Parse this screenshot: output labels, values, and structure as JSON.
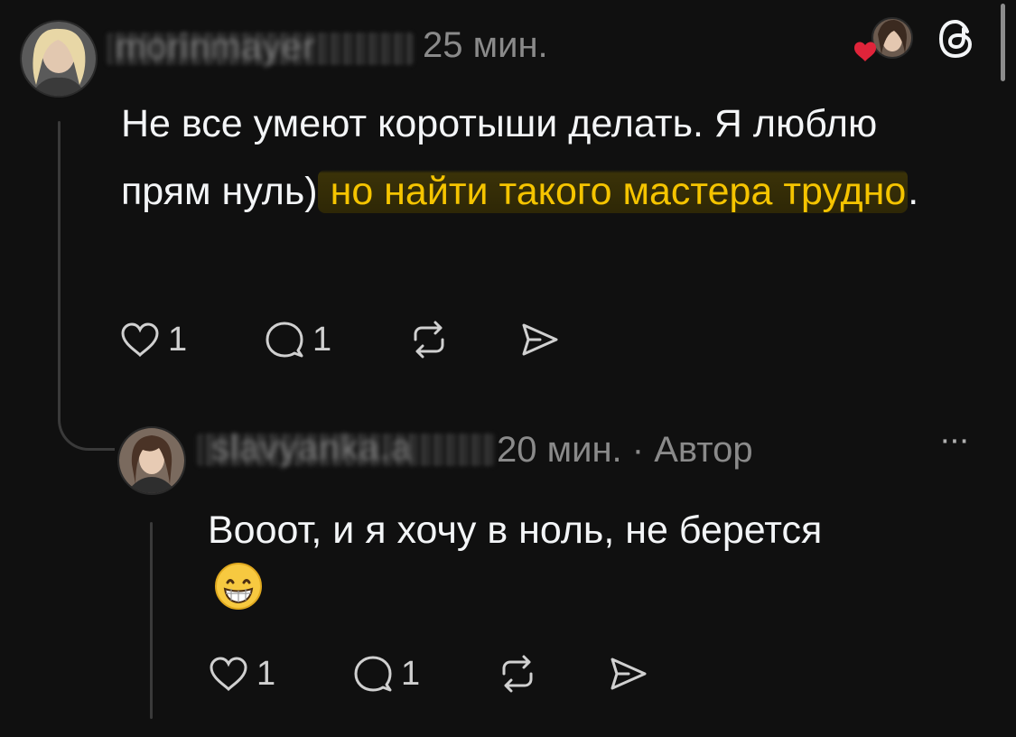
{
  "comment1": {
    "username": "morinmayer",
    "time": "25 мин.",
    "text_plain": "Не все умеют коротыши делать. Я люблю прям нуль)",
    "text_highlight": " но найти такого мастера трудно",
    "text_tail": ".",
    "likes": "1",
    "replies": "1"
  },
  "comment2": {
    "username": "slavyanka.a",
    "time": "20 мин.",
    "separator": "·",
    "author_badge": "Автор",
    "text": "Вооот, и я хочу в ноль, не берется",
    "emoji": "😁",
    "likes": "1",
    "replies": "1"
  },
  "header": {
    "more_glyph": "···"
  },
  "colors": {
    "background": "#101010",
    "highlight_text": "#f5c400",
    "highlight_bg": "#2e2706",
    "like_heart": "#e0243a"
  },
  "icons": [
    "heart-icon",
    "comment-icon",
    "repost-icon",
    "share-icon",
    "threads-logo-icon",
    "more-icon"
  ]
}
